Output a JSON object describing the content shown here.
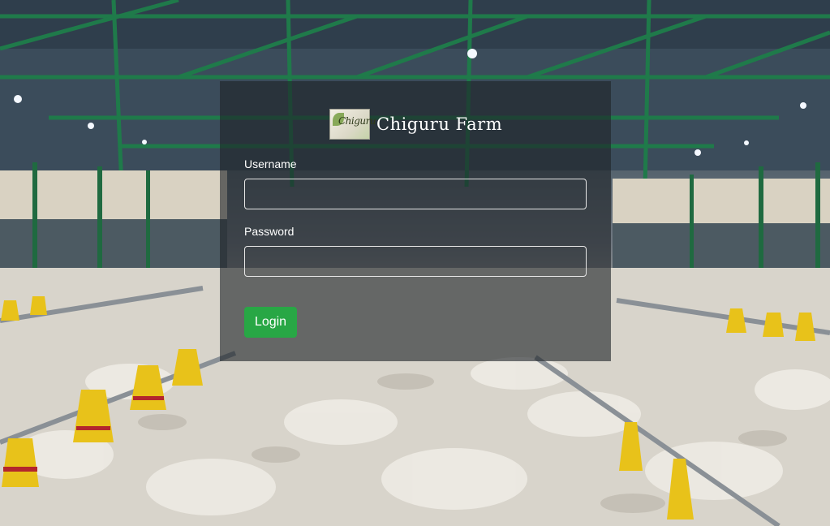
{
  "brand": {
    "logo_text": "Chiguru",
    "name": "Chiguru Farm"
  },
  "form": {
    "username_label": "Username",
    "username_value": "",
    "password_label": "Password",
    "password_value": "",
    "login_label": "Login"
  },
  "colors": {
    "login_button": "#28a745",
    "panel_overlay": "rgba(30,36,40,0.62)",
    "field_border": "#e6e6e6"
  }
}
